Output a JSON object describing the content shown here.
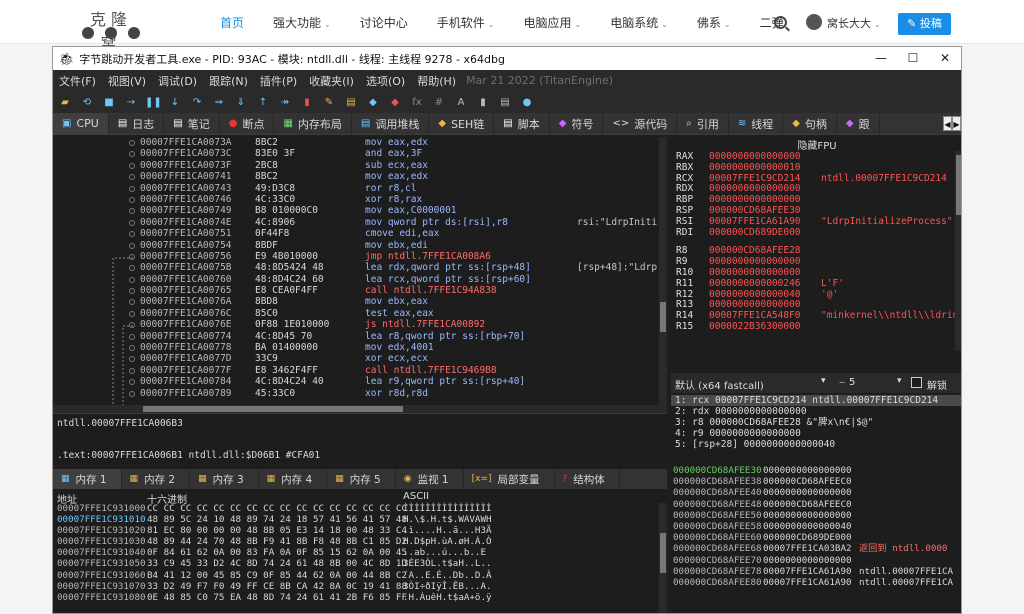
{
  "site": {
    "logo_text": "克隆窝",
    "nav": [
      {
        "label": "首页",
        "active": true,
        "caret": false
      },
      {
        "label": "强大功能",
        "caret": true
      },
      {
        "label": "讨论中心",
        "caret": false
      },
      {
        "label": "手机软件",
        "caret": true
      },
      {
        "label": "电脑应用",
        "caret": true
      },
      {
        "label": "电脑系统",
        "caret": true
      },
      {
        "label": "佛系",
        "caret": true
      },
      {
        "label": "二弹",
        "caret": false
      }
    ],
    "user": "窝长大大",
    "post_label": "投稿"
  },
  "window": {
    "title": "字节跳动开发者工具.exe - PID: 93AC - 模块: ntdll.dll - 线程: 主线程 9278 - x64dbg",
    "controls": [
      "—",
      "☐",
      "✕"
    ]
  },
  "menu": [
    "文件(F)",
    "视图(V)",
    "调试(D)",
    "跟踪(N)",
    "插件(P)",
    "收藏夹(I)",
    "选项(O)",
    "帮助(H)"
  ],
  "menu_date": "Mar 21 2022 (TitanEngine)",
  "toolbar": [
    {
      "g": "▰",
      "c": "#e8b64a"
    },
    {
      "g": "⟲",
      "c": "#6ec6ff"
    },
    {
      "g": "■",
      "c": "#6ec6ff"
    },
    {
      "g": "→",
      "c": "#6ec6ff"
    },
    {
      "g": "❚❚",
      "c": "#6ec6ff"
    },
    {
      "g": "↓",
      "c": "#6ec6ff"
    },
    {
      "g": "↷",
      "c": "#6ec6ff"
    },
    {
      "g": "⇒",
      "c": "#6ec6ff"
    },
    {
      "g": "⇓",
      "c": "#6ec6ff"
    },
    {
      "g": "↑",
      "c": "#6ec6ff"
    },
    {
      "g": "↠",
      "c": "#6ec6ff"
    },
    {
      "g": "▮",
      "c": "#d55"
    },
    {
      "g": "✎",
      "c": "#e8b64a"
    },
    {
      "g": "▤",
      "c": "#e8b64a"
    },
    {
      "g": "◆",
      "c": "#6ec6ff"
    },
    {
      "g": "◆",
      "c": "#e55"
    },
    {
      "g": "fx",
      "c": "#888"
    },
    {
      "g": "#",
      "c": "#888"
    },
    {
      "g": "A",
      "c": "#bbb"
    },
    {
      "g": "▮",
      "c": "#bbb"
    },
    {
      "g": "▤",
      "c": "#bbb"
    },
    {
      "g": "●",
      "c": "#6ec6ff"
    }
  ],
  "tabs": [
    {
      "icon": "▣",
      "label": "CPU",
      "active": true,
      "c": "#6ec6ff"
    },
    {
      "icon": "▤",
      "label": "日志",
      "c": "#fff"
    },
    {
      "icon": "▤",
      "label": "笔记",
      "c": "#fff"
    },
    {
      "icon": "●",
      "label": "断点",
      "c": "#e33"
    },
    {
      "icon": "▦",
      "label": "内存布局",
      "c": "#7d7"
    },
    {
      "icon": "▤",
      "label": "调用堆栈",
      "c": "#6ec6ff"
    },
    {
      "icon": "◆",
      "label": "SEH链",
      "c": "#e8b64a"
    },
    {
      "icon": "▤",
      "label": "脚本",
      "c": "#fff"
    },
    {
      "icon": "◆",
      "label": "符号",
      "c": "#c6f"
    },
    {
      "icon": "<>",
      "label": "源代码",
      "c": "#ddd"
    },
    {
      "icon": "⌕",
      "label": "引用",
      "c": "#ddd"
    },
    {
      "icon": "≋",
      "label": "线程",
      "c": "#6ec6ff"
    },
    {
      "icon": "◆",
      "label": "句柄",
      "c": "#e8b64a"
    },
    {
      "icon": "◆",
      "label": "跟",
      "c": "#c6f"
    }
  ],
  "disasm": [
    {
      "a": "00007FFE1CA0073A",
      "b": "8BC2",
      "i": "mov eax,edx",
      "c": ""
    },
    {
      "a": "00007FFE1CA0073C",
      "b": "83E0 3F",
      "i": "and eax,3F",
      "c": ""
    },
    {
      "a": "00007FFE1CA0073F",
      "b": "2BC8",
      "i": "sub ecx,eax",
      "c": ""
    },
    {
      "a": "00007FFE1CA00741",
      "b": "8BC2",
      "i": "mov eax,edx",
      "c": ""
    },
    {
      "a": "00007FFE1CA00743",
      "b": "49:D3C8",
      "i": "ror r8,cl",
      "c": ""
    },
    {
      "a": "00007FFE1CA00746",
      "b": "4C:33C0",
      "i": "xor r8,rax",
      "c": ""
    },
    {
      "a": "00007FFE1CA00749",
      "b": "B8 010000C0",
      "i": "mov eax,C0000001",
      "c": ""
    },
    {
      "a": "00007FFE1CA0074E",
      "b": "4C:8906",
      "i": "mov qword ptr ds:[rsi],r8",
      "c": "rsi:\"LdrpIniti"
    },
    {
      "a": "00007FFE1CA00751",
      "b": "0F44F8",
      "i": "cmove edi,eax",
      "c": ""
    },
    {
      "a": "00007FFE1CA00754",
      "b": "8BDF",
      "i": "mov ebx,edi",
      "c": ""
    },
    {
      "a": "00007FFE1CA00756",
      "b": "E9 4B010000",
      "i": "jmp ntdll.7FFE1CA008A6",
      "c": ""
    },
    {
      "a": "00007FFE1CA0075B",
      "b": "48:8D5424 48",
      "i": "lea rdx,qword ptr ss:[rsp+48]",
      "c": "[rsp+48]:\"Ldrp"
    },
    {
      "a": "00007FFE1CA00760",
      "b": "48:8D4C24 60",
      "i": "lea rcx,qword ptr ss:[rsp+60]",
      "c": ""
    },
    {
      "a": "00007FFE1CA00765",
      "b": "E8 CEA0F4FF",
      "i": "call ntdll.7FFE1C94A838",
      "c": ""
    },
    {
      "a": "00007FFE1CA0076A",
      "b": "8BD8",
      "i": "mov ebx,eax",
      "c": ""
    },
    {
      "a": "00007FFE1CA0076C",
      "b": "85C0",
      "i": "test eax,eax",
      "c": ""
    },
    {
      "a": "00007FFE1CA0076E",
      "b": "0F88 1E010000",
      "i": "js ntdll.7FFE1CA00892",
      "c": ""
    },
    {
      "a": "00007FFE1CA00774",
      "b": "4C:8D45 70",
      "i": "lea r8,qword ptr ss:[rbp+70]",
      "c": ""
    },
    {
      "a": "00007FFE1CA00778",
      "b": "BA 01400000",
      "i": "mov edx,4001",
      "c": ""
    },
    {
      "a": "00007FFE1CA0077D",
      "b": "33C9",
      "i": "xor ecx,ecx",
      "c": ""
    },
    {
      "a": "00007FFE1CA0077F",
      "b": "E8 3462F4FF",
      "i": "call ntdll.7FFE1C9469B8",
      "c": ""
    },
    {
      "a": "00007FFE1CA00784",
      "b": "4C:8D4C24 40",
      "i": "lea r9,qword ptr ss:[rsp+40]",
      "c": ""
    },
    {
      "a": "00007FFE1CA00789",
      "b": "45:33C0",
      "i": "xor r8d,r8d",
      "c": ""
    }
  ],
  "info": {
    "line1": "ntdll.00007FFE1CA006B3",
    "line2": ".text:00007FFE1CA006B1 ntdll.dll:$D06B1 #CFA01"
  },
  "regs_header": "隐藏FPU",
  "regs": [
    {
      "n": "RAX",
      "v": "0000000000000000",
      "d": ""
    },
    {
      "n": "RBX",
      "v": "0000000000000010",
      "d": ""
    },
    {
      "n": "RCX",
      "v": "00007FFE1C9CD214",
      "d": "ntdll.00007FFE1C9CD214"
    },
    {
      "n": "RDX",
      "v": "0000000000000000",
      "d": ""
    },
    {
      "n": "RBP",
      "v": "0000000000000000",
      "d": ""
    },
    {
      "n": "RSP",
      "v": "000000CD68AFEE30",
      "d": ""
    },
    {
      "n": "RSI",
      "v": "00007FFE1CA61A90",
      "d": "\"LdrpInitializeProcess\""
    },
    {
      "n": "RDI",
      "v": "000000CD689DE000",
      "d": ""
    },
    {
      "n": "",
      "v": "",
      "d": ""
    },
    {
      "n": "R8",
      "v": "000000CD68AFEE28",
      "d": ""
    },
    {
      "n": "R9",
      "v": "0000000000000000",
      "d": ""
    },
    {
      "n": "R10",
      "v": "0000000000000000",
      "d": ""
    },
    {
      "n": "R11",
      "v": "0000000000000246",
      "d": "L'F'"
    },
    {
      "n": "R12",
      "v": "0000000000000040",
      "d": "'@'"
    },
    {
      "n": "R13",
      "v": "0000000000000000",
      "d": ""
    },
    {
      "n": "R14",
      "v": "00007FFE1CA548F0",
      "d": "\"minkernel\\\\ntdll\\\\ldrin"
    },
    {
      "n": "R15",
      "v": "0000022B36300000",
      "d": ""
    }
  ],
  "callconv": {
    "label": "默认 (x64 fastcall)",
    "count": "5",
    "unlock": "解锁"
  },
  "stack_args": [
    "1: rcx 00007FFE1C9CD214 ntdll.00007FFE1C9CD214",
    "2: rdx 0000000000000000",
    "3: r8 000000CD68AFEE28 &\"脾x\\n€|$@\"",
    "4: r9 0000000000000000",
    "5: [rsp+28] 0000000000000040"
  ],
  "dump_tabs": [
    {
      "icon": "▦",
      "label": "内存 1",
      "active": true,
      "c": "#6ec6ff"
    },
    {
      "icon": "▦",
      "label": "内存 2",
      "c": "#e8b64a"
    },
    {
      "icon": "▦",
      "label": "内存 3",
      "c": "#e8b64a"
    },
    {
      "icon": "▦",
      "label": "内存 4",
      "c": "#e8b64a"
    },
    {
      "icon": "▦",
      "label": "内存 5",
      "c": "#e8b64a"
    },
    {
      "icon": "◉",
      "label": "监视 1",
      "c": "#e8b64a"
    },
    {
      "icon": "[x=]",
      "label": "局部变量",
      "c": "#e8b64a"
    },
    {
      "icon": "?",
      "label": "结构体",
      "c": "#e33"
    }
  ],
  "dump_header": {
    "addr": "地址",
    "hex": "十六进制",
    "ascii": "ASCII"
  },
  "dump": [
    {
      "a": "00007FFE1C931000",
      "h": "CC CC CC CC CC CC CC CC CC CC CC CC CC CC CC CC",
      "s": "ÌÌÌÌÌÌÌÌÌÌÌÌÌÌÌÌ"
    },
    {
      "a": "00007FFE1C931010",
      "h": "48 89 5C 24 10 48 89 74 24 18 57 41 56 41 57 48",
      "s": "H.\\$.H.t$.WAVAWH"
    },
    {
      "a": "00007FFE1C931020",
      "h": "81 EC 80 00 00 00 48 8B 05 E3 14 18 00 48 33 C4",
      "s": ".ì....H..ã...H3Ä"
    },
    {
      "a": "00007FFE1C931030",
      "h": "48 89 44 24 70 48 8B F9 41 8B F8 48 8B C1 85 D2",
      "s": "H.D$pH.ùA.øH.Á.Ò"
    },
    {
      "a": "00007FFE1C931040",
      "h": "0F 84 61 62 0A 00 83 FA 0A 0F 85 15 62 0A 00 45",
      "s": "..ab...ú...b..E"
    },
    {
      "a": "00007FFE1C931050",
      "h": "33 C9 45 33 D2 4C 8D 74 24 61 48 8B 00 4C 8D 1D",
      "s": "3ÉE3ÒL.t$aH..L.."
    },
    {
      "a": "00007FFE1C931060",
      "h": "B4 41 12 00 45 85 C9 0F 85 44 62 0A 00 44 8B C2",
      "s": "´A..E.É..Db..D.Â"
    },
    {
      "a": "00007FFE1C931070",
      "h": "33 D2 49 F7 F0 49 FF CE 8B CA 42 8A 0C 19 41 88",
      "s": "3ÒI÷ðIÿÎ.ÊB...A."
    },
    {
      "a": "00007FFE1C931080",
      "h": "0E 48 85 C0 75 EA 48 8D 74 24 61 41 2B F6 85 FF",
      "s": ".H.ÀuêH.t$aA+ö.ÿ"
    }
  ],
  "stack": [
    {
      "a": "000000CD68AFEE30",
      "v": "0000000000000000",
      "c": ""
    },
    {
      "a": "000000CD68AFEE38",
      "v": "000000CD68AFEEC0",
      "c": ""
    },
    {
      "a": "000000CD68AFEE40",
      "v": "0000000000000000",
      "c": ""
    },
    {
      "a": "000000CD68AFEE48",
      "v": "000000CD68AFEEC0",
      "c": ""
    },
    {
      "a": "000000CD68AFEE50",
      "v": "0000000000000000",
      "c": ""
    },
    {
      "a": "000000CD68AFEE58",
      "v": "0000000000000040",
      "c": ""
    },
    {
      "a": "000000CD68AFEE60",
      "v": "000000CD689DE000",
      "c": ""
    },
    {
      "a": "000000CD68AFEE68",
      "v": "00007FFE1CA03BA2",
      "c": "返回到 ntdll.0000"
    },
    {
      "a": "000000CD68AFEE70",
      "v": "0000000000000000",
      "c": ""
    },
    {
      "a": "000000CD68AFEE78",
      "v": "00007FFE1CA61A90",
      "c": "ntdll.00007FFE1CA"
    },
    {
      "a": "000000CD68AFEE80",
      "v": "00007FFE1CA61A90",
      "c": "ntdll.00007FFE1CA"
    }
  ],
  "colors": {
    "address_highlight": "#6ec6ff",
    "register_red": "#ff5252",
    "instruction_blue": "#9cb8ff",
    "return_red": "#ff6b6b",
    "stack_top": "#5fd35f"
  }
}
